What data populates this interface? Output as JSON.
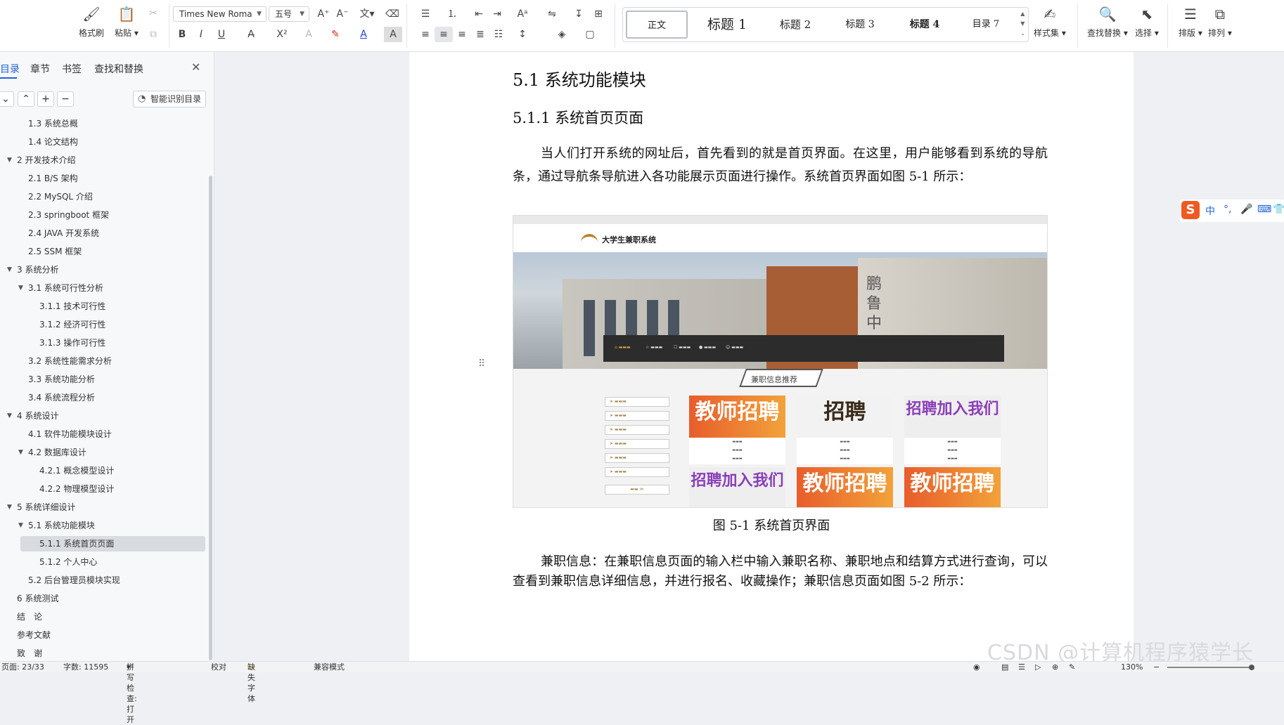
{
  "ribbon": {
    "format_painter": "格式刷",
    "paste": "粘贴",
    "font_name": "Times New Roma",
    "font_size": "五号",
    "style_set": "样式集",
    "find_replace": "查找替换",
    "select": "选择",
    "layout": "排版",
    "arrange": "排列",
    "styles": [
      "正文",
      "标题 1",
      "标题 2",
      "标题 3",
      "标题 4",
      "目录 7"
    ]
  },
  "sidepanel": {
    "tabs": [
      "目录",
      "章节",
      "书签",
      "查找和替换"
    ],
    "smart_toc": "智能识别目录",
    "toc": [
      {
        "text": "1.3 系统总概",
        "level": 2
      },
      {
        "text": "1.4 论文结构",
        "level": 2
      },
      {
        "text": "2 开发技术介绍",
        "level": 1,
        "expanded": true
      },
      {
        "text": "2.1 B/S 架构",
        "level": 2
      },
      {
        "text": "2.2 MySQL 介绍",
        "level": 2
      },
      {
        "text": "2.3 springboot 框架",
        "level": 2
      },
      {
        "text": "2.4 JAVA 开发系统",
        "level": 2
      },
      {
        "text": "2.5 SSM 框架",
        "level": 2
      },
      {
        "text": "3 系统分析",
        "level": 1,
        "expanded": true
      },
      {
        "text": "3.1 系统可行性分析",
        "level": 2,
        "expanded": true
      },
      {
        "text": "3.1.1 技术可行性",
        "level": 3
      },
      {
        "text": "3.1.2 经济可行性",
        "level": 3
      },
      {
        "text": "3.1.3 操作可行性",
        "level": 3
      },
      {
        "text": "3.2 系统性能需求分析",
        "level": 2
      },
      {
        "text": "3.3 系统功能分析",
        "level": 2
      },
      {
        "text": "3.4 系统流程分析",
        "level": 2
      },
      {
        "text": "4 系统设计",
        "level": 1,
        "expanded": true
      },
      {
        "text": "4.1  软件功能模块设计",
        "level": 2
      },
      {
        "text": "4.2  数据库设计",
        "level": 2,
        "expanded": true
      },
      {
        "text": "4.2.1  概念模型设计",
        "level": 3
      },
      {
        "text": "4.2.2  物理模型设计",
        "level": 3
      },
      {
        "text": "5 系统详细设计",
        "level": 1,
        "expanded": true
      },
      {
        "text": "5.1 系统功能模块",
        "level": 2,
        "expanded": true
      },
      {
        "text": "5.1.1 系统首页页面",
        "level": 3,
        "selected": true
      },
      {
        "text": "5.1.2 个人中心",
        "level": 3
      },
      {
        "text": "5.2 后台管理员模块实现",
        "level": 2
      },
      {
        "text": "6 系统测试",
        "level": 1
      },
      {
        "text": "结　论",
        "level": 1
      },
      {
        "text": "参考文献",
        "level": 1
      },
      {
        "text": "致　谢",
        "level": 1
      }
    ]
  },
  "document": {
    "heading1": "5.1 系统功能模块",
    "heading2": "5.1.1 系统首页页面",
    "para1": "当人们打开系统的网址后，首先看到的就是首页界面。在这里，用户能够看到系统的导航条，通过导航条导航进入各功能展示页面进行操作。系统首页界面如图 5-1 所示：",
    "caption": "图 5-1  系统首页界面",
    "para2": "兼职信息：在兼职信息页面的输入栏中输入兼职名称、兼职地点和结算方式进行查询，可以查看到兼职信息详细信息，并进行报名、收藏操作；兼职信息页面如图 5-2 所示：",
    "figure": {
      "site_name": "大学生兼职系统",
      "section_title": "兼职信息推荐",
      "banner_sign": "鹏鲁中西",
      "cards": [
        "教师招聘",
        "招聘",
        "招聘加入我们",
        "招聘加入我们",
        "教师招聘",
        "教师招聘"
      ]
    }
  },
  "statusbar": {
    "page": "页面: 23/33",
    "words": "字数: 11595",
    "spell": "拼写检查: 打开",
    "proof": "校对",
    "missing_font": "缺失字体",
    "compat": "兼容模式",
    "zoom": "130%"
  },
  "ime": {
    "logo": "S",
    "lang": "中"
  },
  "watermark": "CSDN @计算机程序猿学长"
}
